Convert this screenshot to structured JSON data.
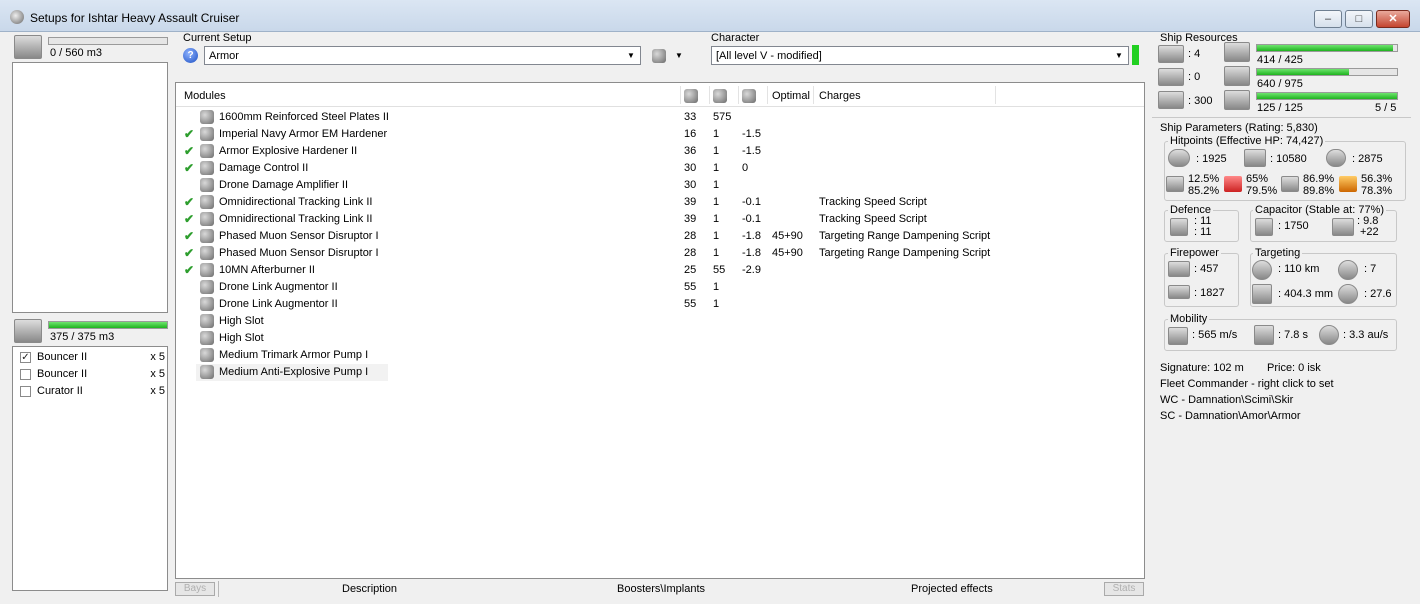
{
  "window": {
    "title": "Setups for Ishtar Heavy Assault Cruiser",
    "minimize": "–",
    "maximize": "□",
    "close": "✕"
  },
  "cargo": {
    "label": "0 / 560 m3",
    "fill": 0
  },
  "drone_bay": {
    "label": "375 / 375 m3",
    "fill": 1.0
  },
  "drones": [
    {
      "name": "Bouncer II",
      "qty": "x 5",
      "checked": true
    },
    {
      "name": "Bouncer II",
      "qty": "x 5",
      "checked": false
    },
    {
      "name": "Curator II",
      "qty": "x 5",
      "checked": false
    }
  ],
  "setup": {
    "label": "Current Setup",
    "value": "Armor",
    "help_icon": "question-icon"
  },
  "character": {
    "label": "Character",
    "value": "[All level V - modified]"
  },
  "modules": {
    "headers": {
      "name": "Modules",
      "optimal": "Optimal",
      "charges": "Charges"
    },
    "rows": [
      {
        "active": false,
        "name": "1600mm Reinforced Steel Plates II",
        "cpu": "33",
        "pg": "575",
        "cap": "",
        "optimal": "",
        "charges": ""
      },
      {
        "active": true,
        "name": "Imperial Navy Armor EM Hardener",
        "cpu": "16",
        "pg": "1",
        "cap": "-1.5",
        "optimal": "",
        "charges": ""
      },
      {
        "active": true,
        "name": "Armor Explosive Hardener II",
        "cpu": "36",
        "pg": "1",
        "cap": "-1.5",
        "optimal": "",
        "charges": ""
      },
      {
        "active": true,
        "name": "Damage Control II",
        "cpu": "30",
        "pg": "1",
        "cap": "0",
        "optimal": "",
        "charges": ""
      },
      {
        "active": false,
        "name": "Drone Damage Amplifier II",
        "cpu": "30",
        "pg": "1",
        "cap": "",
        "optimal": "",
        "charges": ""
      },
      {
        "active": true,
        "name": "Omnidirectional Tracking Link II",
        "cpu": "39",
        "pg": "1",
        "cap": "-0.1",
        "optimal": "",
        "charges": "Tracking Speed Script"
      },
      {
        "active": true,
        "name": "Omnidirectional Tracking Link II",
        "cpu": "39",
        "pg": "1",
        "cap": "-0.1",
        "optimal": "",
        "charges": "Tracking Speed Script"
      },
      {
        "active": true,
        "name": "Phased Muon Sensor Disruptor I",
        "cpu": "28",
        "pg": "1",
        "cap": "-1.8",
        "optimal": "45+90",
        "charges": "Targeting Range Dampening Script"
      },
      {
        "active": true,
        "name": "Phased Muon Sensor Disruptor I",
        "cpu": "28",
        "pg": "1",
        "cap": "-1.8",
        "optimal": "45+90",
        "charges": "Targeting Range Dampening Script"
      },
      {
        "active": true,
        "name": "10MN Afterburner II",
        "cpu": "25",
        "pg": "55",
        "cap": "-2.9",
        "optimal": "",
        "charges": ""
      },
      {
        "active": false,
        "name": "Drone Link Augmentor II",
        "cpu": "55",
        "pg": "1",
        "cap": "",
        "optimal": "",
        "charges": ""
      },
      {
        "active": false,
        "name": "Drone Link Augmentor II",
        "cpu": "55",
        "pg": "1",
        "cap": "",
        "optimal": "",
        "charges": ""
      },
      {
        "active": false,
        "name": "High Slot",
        "cpu": "",
        "pg": "",
        "cap": "",
        "optimal": "",
        "charges": ""
      },
      {
        "active": false,
        "name": "High Slot",
        "cpu": "",
        "pg": "",
        "cap": "",
        "optimal": "",
        "charges": ""
      },
      {
        "active": false,
        "name": "Medium Trimark Armor Pump I",
        "cpu": "",
        "pg": "",
        "cap": "",
        "optimal": "",
        "charges": ""
      },
      {
        "active": false,
        "name": "Medium Anti-Explosive Pump I",
        "cpu": "",
        "pg": "",
        "cap": "",
        "optimal": "",
        "charges": ""
      }
    ]
  },
  "bottom": {
    "bays": "Bays",
    "description": "Description",
    "boosters": "Boosters\\Implants",
    "projected": "Projected effects",
    "stats": "Stats"
  },
  "resources": {
    "title": "Ship Resources",
    "turret": ": 4",
    "launcher": ": 0",
    "calibration": ": 300",
    "cpu": {
      "label": "414 / 425",
      "fill": 0.974
    },
    "powergrid": {
      "label": "640 / 975",
      "fill": 0.656
    },
    "drone_bw": {
      "label": "125 / 125",
      "fill": 1.0
    },
    "drones_active": "5 / 5"
  },
  "params": {
    "title": "Ship Parameters (Rating: 5,830)",
    "hitpoints": {
      "title": "Hitpoints (Effective HP: 74,427)",
      "shield": ": 1925",
      "armor": ": 10580",
      "structure": ": 2875",
      "res_em": [
        "12.5%",
        "85.2%"
      ],
      "res_therm": [
        "65%",
        "79.5%"
      ],
      "res_kin": [
        "86.9%",
        "89.8%"
      ],
      "res_exp": [
        "56.3%",
        "78.3%"
      ]
    },
    "defence": {
      "title": "Defence",
      "v1": ": 11",
      "v2": ": 11"
    },
    "capacitor": {
      "title": "Capacitor (Stable at: 77%)",
      "amount": ": 1750",
      "v1": ": 9.8",
      "v2": "+22"
    },
    "firepower": {
      "title": "Firepower",
      "dps": ": 457",
      "volley": ": 1827"
    },
    "targeting": {
      "title": "Targeting",
      "range": ": 110 km",
      "targets": ": 7",
      "res": ": 404.3 mm",
      "sensor": ": 27.6"
    },
    "mobility": {
      "title": "Mobility",
      "speed": ": 565 m/s",
      "align": ": 7.8 s",
      "warp": ": 3.3 au/s"
    }
  },
  "footer_info": {
    "signature": "Signature: 102 m",
    "price": "Price: 0 isk",
    "fleet": "Fleet Commander - right click to set",
    "wc": "WC - Damnation\\Scimi\\Skir",
    "sc": "SC - Damnation\\Amor\\Armor"
  }
}
